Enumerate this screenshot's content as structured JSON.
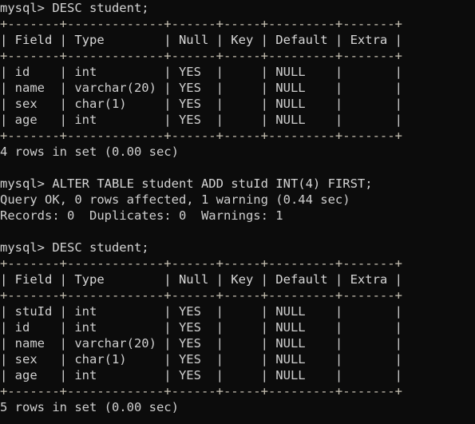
{
  "terminal": {
    "prompt": "mysql> ",
    "colors": {
      "background": "#0c0c0c",
      "foreground": "#cfcfcf",
      "rule": "#c8c2b4"
    },
    "lines": [
      {
        "kind": "prompt",
        "text": "mysql> DESC student;"
      },
      {
        "kind": "rule",
        "text": "+-------+-------------+------+-----+---------+-------+"
      },
      {
        "kind": "head",
        "text": "| Field | Type        | Null | Key | Default | Extra |"
      },
      {
        "kind": "rule",
        "text": "+-------+-------------+------+-----+---------+-------+"
      },
      {
        "kind": "row",
        "text": "| id    | int         | YES  |     | NULL    |       |"
      },
      {
        "kind": "row",
        "text": "| name  | varchar(20) | YES  |     | NULL    |       |"
      },
      {
        "kind": "row",
        "text": "| sex   | char(1)     | YES  |     | NULL    |       |"
      },
      {
        "kind": "row",
        "text": "| age   | int         | YES  |     | NULL    |       |"
      },
      {
        "kind": "rule",
        "text": "+-------+-------------+------+-----+---------+-------+"
      },
      {
        "kind": "result",
        "text": "4 rows in set (0.00 sec)"
      },
      {
        "kind": "blank",
        "text": " "
      },
      {
        "kind": "prompt",
        "text": "mysql> ALTER TABLE student ADD stuId INT(4) FIRST;"
      },
      {
        "kind": "result",
        "text": "Query OK, 0 rows affected, 1 warning (0.44 sec)"
      },
      {
        "kind": "result",
        "text": "Records: 0  Duplicates: 0  Warnings: 1"
      },
      {
        "kind": "blank",
        "text": " "
      },
      {
        "kind": "prompt",
        "text": "mysql> DESC student;"
      },
      {
        "kind": "rule",
        "text": "+-------+-------------+------+-----+---------+-------+"
      },
      {
        "kind": "head",
        "text": "| Field | Type        | Null | Key | Default | Extra |"
      },
      {
        "kind": "rule",
        "text": "+-------+-------------+------+-----+---------+-------+"
      },
      {
        "kind": "row",
        "text": "| stuId | int         | YES  |     | NULL    |       |"
      },
      {
        "kind": "row",
        "text": "| id    | int         | YES  |     | NULL    |       |"
      },
      {
        "kind": "row",
        "text": "| name  | varchar(20) | YES  |     | NULL    |       |"
      },
      {
        "kind": "row",
        "text": "| sex   | char(1)     | YES  |     | NULL    |       |"
      },
      {
        "kind": "row",
        "text": "| age   | int         | YES  |     | NULL    |       |"
      },
      {
        "kind": "rule",
        "text": "+-------+-------------+------+-----+---------+-------+"
      },
      {
        "kind": "result",
        "text": "5 rows in set (0.00 sec)"
      }
    ],
    "commands": [
      {
        "index": 0,
        "text": "DESC student;"
      },
      {
        "index": 1,
        "text": "ALTER TABLE student ADD stuId INT(4) FIRST;"
      },
      {
        "index": 2,
        "text": "DESC student;"
      }
    ],
    "tables": [
      {
        "name": "student-describe-before",
        "columns": [
          "Field",
          "Type",
          "Null",
          "Key",
          "Default",
          "Extra"
        ],
        "rows": [
          [
            "id",
            "int",
            "YES",
            "",
            "NULL",
            ""
          ],
          [
            "name",
            "varchar(20)",
            "YES",
            "",
            "NULL",
            ""
          ],
          [
            "sex",
            "char(1)",
            "YES",
            "",
            "NULL",
            ""
          ],
          [
            "age",
            "int",
            "YES",
            "",
            "NULL",
            ""
          ]
        ],
        "footer": "4 rows in set (0.00 sec)"
      },
      {
        "name": "student-describe-after",
        "columns": [
          "Field",
          "Type",
          "Null",
          "Key",
          "Default",
          "Extra"
        ],
        "rows": [
          [
            "stuId",
            "int",
            "YES",
            "",
            "NULL",
            ""
          ],
          [
            "id",
            "int",
            "YES",
            "",
            "NULL",
            ""
          ],
          [
            "name",
            "varchar(20)",
            "YES",
            "",
            "NULL",
            ""
          ],
          [
            "sex",
            "char(1)",
            "YES",
            "",
            "NULL",
            ""
          ],
          [
            "age",
            "int",
            "YES",
            "",
            "NULL",
            ""
          ]
        ],
        "footer": "5 rows in set (0.00 sec)"
      }
    ],
    "alter_result": {
      "status": "Query OK, 0 rows affected, 1 warning (0.44 sec)",
      "counters": "Records: 0  Duplicates: 0  Warnings: 1"
    }
  }
}
